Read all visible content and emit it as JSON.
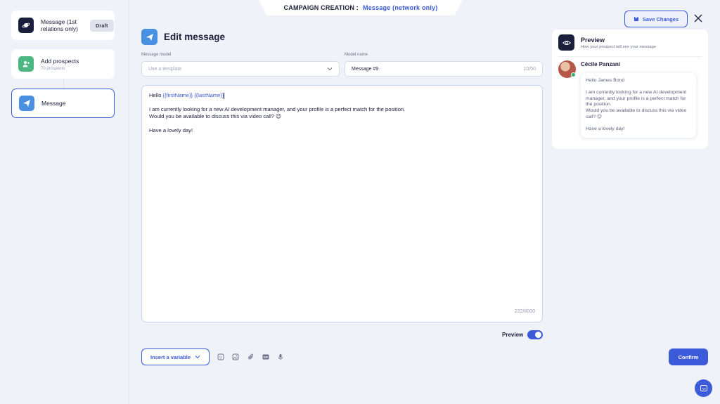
{
  "banner": {
    "label": "CAMPAIGN CREATION :",
    "value": "Message (network only)"
  },
  "steps": [
    {
      "title": "Message (1st relations only)",
      "badge": "Draft"
    },
    {
      "title": "Add prospects",
      "subtitle": "70 prospects"
    },
    {
      "title": "Message"
    }
  ],
  "header": {
    "title": "Edit message"
  },
  "form": {
    "model_label": "Message model",
    "model_placeholder": "Use a template",
    "name_label": "Model name",
    "name_value": "Message #9",
    "name_count": "10/50"
  },
  "editor": {
    "greeting": "Hello",
    "var_first": "{{firstName}}",
    "var_last": "{{lastName}}",
    "line1": "I am currently looking for a new AI development manager, and your profile is a perfect match for the position.",
    "line2": "Would you be available to discuss this via video call? 😉",
    "line3": "Have a lovely day!",
    "char_count": "222/8000"
  },
  "toolbar": {
    "insert_variable": "Insert a variable",
    "preview_label": "Preview",
    "preview_on": true,
    "confirm": "Confirm",
    "save_changes": "Save Changes"
  },
  "preview": {
    "title": "Preview",
    "subtitle": "How your prospect will see your message",
    "name": "Cécile Panzani",
    "hello": "Hello James Bond",
    "body1": "I am currently looking for a new AI development manager, and your profile is a perfect match for the position.",
    "body2": "Would you be available to discuss this via video call? 😉",
    "body3": "Have a lovely day!"
  },
  "colors": {
    "accent": "#3b5bdb",
    "background": "#f0f2fa",
    "online": "#2fb36b"
  }
}
